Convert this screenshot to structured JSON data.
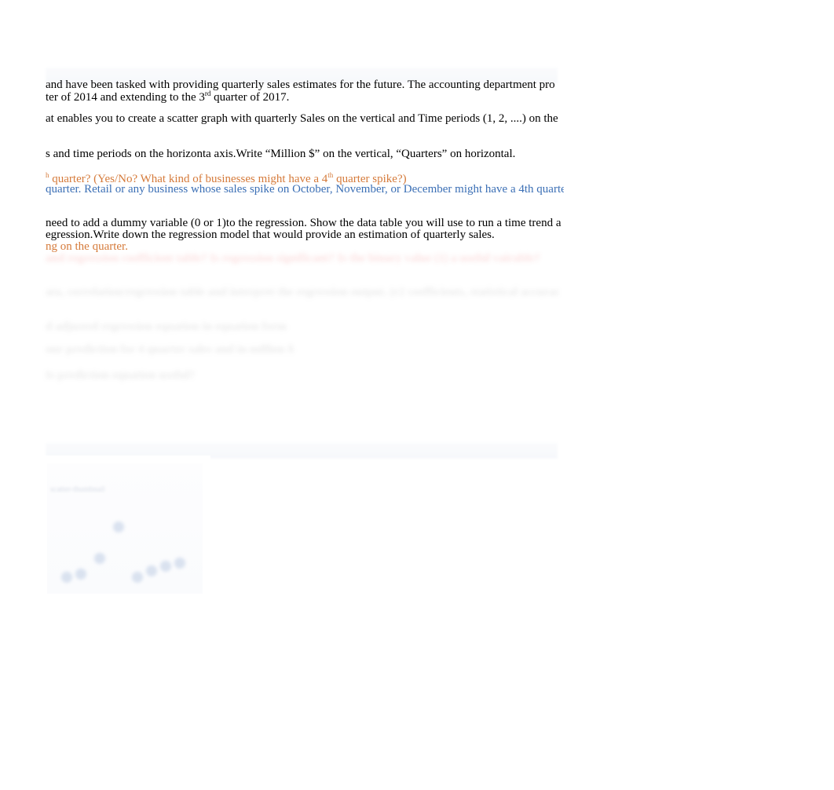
{
  "lines": {
    "l1": " and have been tasked with providing quarterly   sales estimates for the future. The accounting department pro",
    "l2a": "ter of 2014 and extending to the 3",
    "l2sup": "rd",
    "l2b": " quarter of 2017.",
    "l3": " at enables you to create a scatter graph with quarterly Sales on the vertical and Time periods (1, 2,     ....) on the",
    "l4": "s and time periods on the horizonta axis.Write “Million $” on the vertical, “Quarters” on horizontal.",
    "l5sup1": "h",
    "l5a": " quarter? (Yes/No? What kind of businesses might have a 4",
    "l5sup2": "th",
    "l5b": " quarter spike?)",
    "l6": " quarter. Retail or any business whose sales spike on October, November, or December might have a 4th quarte",
    "l7": " need to add a dummy variable (0 or 1)to the regression. Show the data table you will use to run a time trend a",
    "l8": "egression.Write down the regression model that would provide an estimation of quarterly sales.",
    "l9": " ng on the quarter.",
    "r1": "and regression coefficient table? Is regression significant? Is the binary value (1) a useful vairable?",
    "r2": "ata, correlation/regression table and interpret the regression output. (r2 coefficients, statistical accurac",
    "r3": "d adjusted regression equation in equation form",
    "r4": " our prediction for 4 quarter sales and in million $",
    "r5": "Is prediction equation useful?"
  },
  "thumbnail": {
    "label": "scatter-thumbnail"
  }
}
